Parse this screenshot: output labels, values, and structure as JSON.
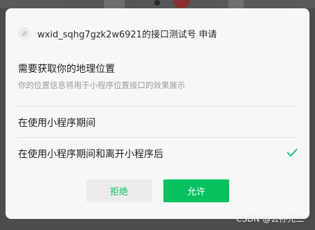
{
  "dialog": {
    "app_name": "wxid_sqhg7gzk2w6921的接口测试号",
    "request_suffix": "申请",
    "title": "需要获取你的地理位置",
    "subtitle": "你的位置信息将用于小程序位置接口的效果展示",
    "options": [
      {
        "label": "在使用小程序期间",
        "selected": false
      },
      {
        "label": "在使用小程序期间和离开小程序后",
        "selected": true
      }
    ],
    "buttons": {
      "reject": "拒绝",
      "allow": "允许"
    },
    "accent_color": "#07c160"
  },
  "watermark": "CSDN @公孙元二",
  "icons": {
    "app": "link-icon",
    "selected": "checkmark-icon"
  }
}
